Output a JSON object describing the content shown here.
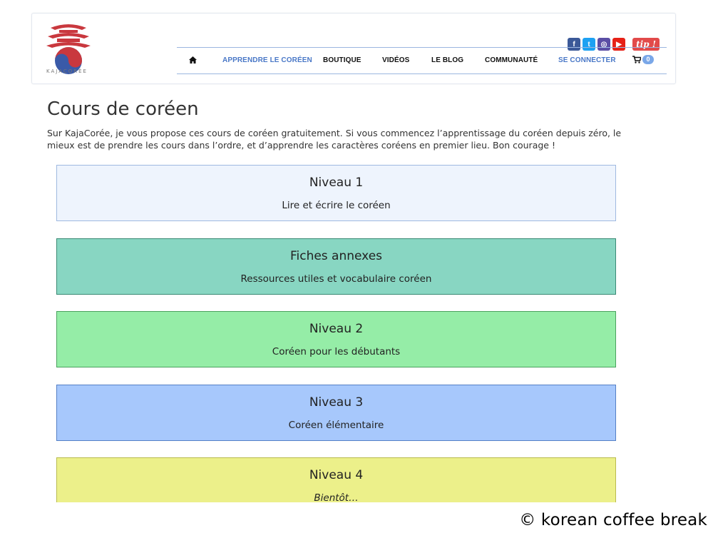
{
  "logo": {
    "text": "KAJACORÉE"
  },
  "social": {
    "facebook_glyph": "f",
    "twitter_glyph": "t",
    "instagram_glyph": "◎",
    "youtube_glyph": "▶",
    "tip_label": "tip !"
  },
  "nav": {
    "items": [
      {
        "label": "APPRENDRE LE CORÉEN"
      },
      {
        "label": "BOUTIQUE"
      },
      {
        "label": "VIDÉOS"
      },
      {
        "label": "LE BLOG"
      },
      {
        "label": "COMMUNAUTÉ"
      },
      {
        "label": "SE CONNECTER"
      }
    ],
    "cart_count": "0"
  },
  "page": {
    "title": "Cours de coréen",
    "intro": "Sur KajaCorée, je vous propose ces cours de coréen gratuitement. Si vous commencez l’apprentissage du coréen depuis zéro, le mieux est de prendre les cours dans l’ordre, et d’apprendre les caractères coréens en premier lieu. Bon courage !"
  },
  "levels": [
    {
      "title": "Niveau 1",
      "subtitle": "Lire et écrire le coréen",
      "color": "#eef4fd"
    },
    {
      "title": "Fiches annexes",
      "subtitle": "Ressources utiles et vocabulaire coréen",
      "color": "#88d6c2"
    },
    {
      "title": "Niveau 2",
      "subtitle": "Coréen pour les débutants",
      "color": "#95eda7"
    },
    {
      "title": "Niveau 3",
      "subtitle": "Coréen élémentaire",
      "color": "#a7c8fc"
    },
    {
      "title": "Niveau 4",
      "subtitle": "Bientôt…",
      "color": "#ecf08a"
    }
  ],
  "watermark": "© korean coffee break"
}
